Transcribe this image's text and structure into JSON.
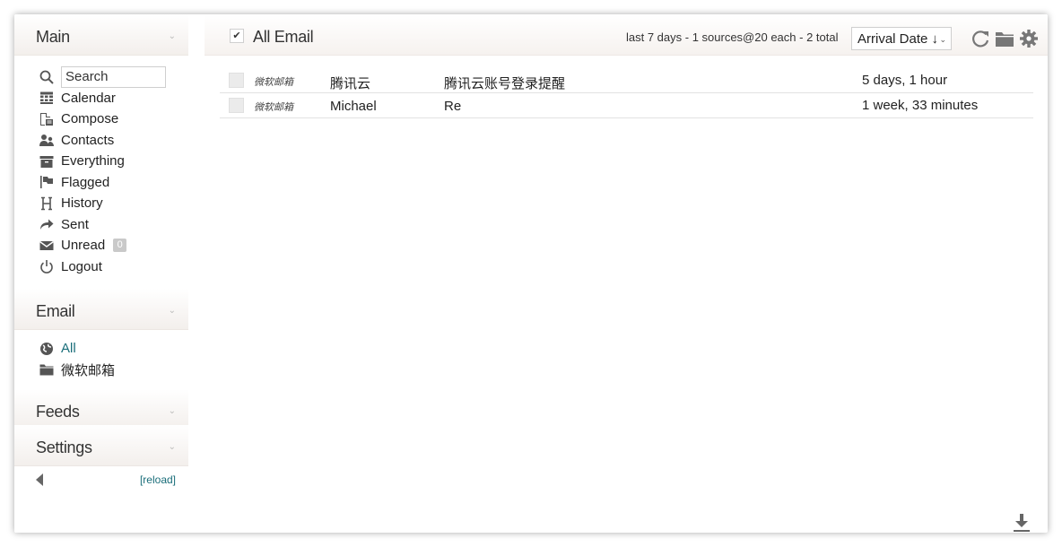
{
  "sidebar": {
    "sections": [
      {
        "title": "Main"
      },
      {
        "title": "Email"
      },
      {
        "title": "Feeds"
      },
      {
        "title": "Settings"
      }
    ],
    "search_placeholder": "Search",
    "main_items": [
      {
        "label": "Calendar",
        "icon": "calendar-icon"
      },
      {
        "label": "Compose",
        "icon": "compose-icon"
      },
      {
        "label": "Contacts",
        "icon": "contacts-icon"
      },
      {
        "label": "Everything",
        "icon": "box-icon"
      },
      {
        "label": "Flagged",
        "icon": "flag-icon"
      },
      {
        "label": "History",
        "icon": "history-icon"
      },
      {
        "label": "Sent",
        "icon": "sent-arrow-icon"
      },
      {
        "label": "Unread",
        "icon": "envelope-icon",
        "badge": "0"
      },
      {
        "label": "Logout",
        "icon": "power-icon"
      }
    ],
    "email_items": [
      {
        "label": "All",
        "icon": "globe-icon"
      },
      {
        "label": "微软邮箱",
        "icon": "folder-icon"
      }
    ],
    "reload": "[reload]"
  },
  "main": {
    "title": "All Email",
    "summary": "last 7 days - 1 sources@20 each - 2 total",
    "sort_label": "Arrival Date ↓",
    "rows": [
      {
        "source": "微软邮箱",
        "from": "腾讯云",
        "subject": "腾讯云账号登录提醒",
        "date": "5 days, 1 hour"
      },
      {
        "source": "微软邮箱",
        "from": "Michael",
        "subject": "Re",
        "date": "1 week, 33 minutes"
      }
    ]
  },
  "colors": {
    "link": "#1a6e7a",
    "header_gradient_end": "#f3efec"
  }
}
